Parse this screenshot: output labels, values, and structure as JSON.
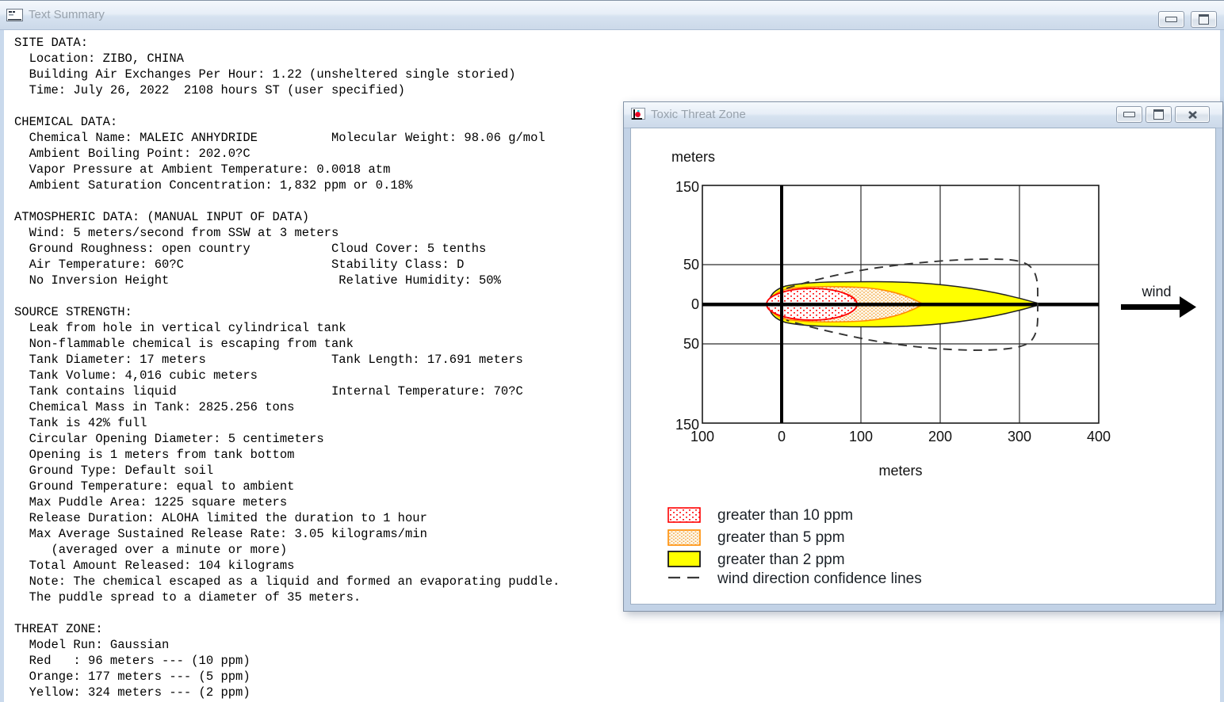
{
  "text_summary_window": {
    "title": "Text Summary",
    "icon": "text-document-icon",
    "controls": {
      "minimize": "Minimize",
      "maximize": "Maximize"
    },
    "content": "SITE DATA:\n  Location: ZIBO, CHINA\n  Building Air Exchanges Per Hour: 1.22 (unsheltered single storied)\n  Time: July 26, 2022  2108 hours ST (user specified)\n\nCHEMICAL DATA:\n  Chemical Name: MALEIC ANHYDRIDE          Molecular Weight: 98.06 g/mol\n  Ambient Boiling Point: 202.0?C\n  Vapor Pressure at Ambient Temperature: 0.0018 atm\n  Ambient Saturation Concentration: 1,832 ppm or 0.18%\n\nATMOSPHERIC DATA: (MANUAL INPUT OF DATA)\n  Wind: 5 meters/second from SSW at 3 meters\n  Ground Roughness: open country           Cloud Cover: 5 tenths\n  Air Temperature: 60?C                    Stability Class: D\n  No Inversion Height                       Relative Humidity: 50%\n\nSOURCE STRENGTH:\n  Leak from hole in vertical cylindrical tank\n  Non-flammable chemical is escaping from tank\n  Tank Diameter: 17 meters                 Tank Length: 17.691 meters\n  Tank Volume: 4,016 cubic meters\n  Tank contains liquid                     Internal Temperature: 70?C\n  Chemical Mass in Tank: 2825.256 tons\n  Tank is 42% full\n  Circular Opening Diameter: 5 centimeters\n  Opening is 1 meters from tank bottom\n  Ground Type: Default soil\n  Ground Temperature: equal to ambient\n  Max Puddle Area: 1225 square meters\n  Release Duration: ALOHA limited the duration to 1 hour\n  Max Average Sustained Release Rate: 3.05 kilograms/min\n     (averaged over a minute or more)\n  Total Amount Released: 104 kilograms\n  Note: The chemical escaped as a liquid and formed an evaporating puddle.\n  The puddle spread to a diameter of 35 meters.\n\nTHREAT ZONE:\n  Model Run: Gaussian\n  Red   : 96 meters --- (10 ppm)\n  Orange: 177 meters --- (5 ppm)\n  Yellow: 324 meters --- (2 ppm)"
  },
  "toxic_window": {
    "title": "Toxic Threat Zone",
    "icon": "threat-plot-icon",
    "controls": {
      "minimize": "Minimize",
      "restore": "Restore",
      "close": "Close"
    }
  },
  "chart_data": {
    "type": "area",
    "title": "Toxic Threat Zone",
    "xlabel": "meters",
    "ylabel": "meters",
    "xlim": [
      -100,
      400
    ],
    "ylim": [
      -150,
      150
    ],
    "x_tick_labels": [
      "100",
      "0",
      "100",
      "200",
      "300",
      "400"
    ],
    "y_tick_labels": [
      "150",
      "50",
      "0",
      "50",
      "150"
    ],
    "grid": true,
    "legend_position": "bottom-left",
    "wind_label": "wind",
    "series": [
      {
        "name": "greater than 10 ppm",
        "threshold_ppm": 10,
        "downwind_extent_m": 96,
        "upwind_extent_m": -19,
        "max_half_width_m": 20,
        "outline_color": "#ff0000",
        "fill": "red dot pattern on white"
      },
      {
        "name": "greater than 5 ppm",
        "threshold_ppm": 5,
        "downwind_extent_m": 177,
        "upwind_extent_m": -14,
        "max_half_width_m": 22,
        "outline_color": "#ff8c00",
        "fill": "orange dot pattern on white"
      },
      {
        "name": "greater than 2 ppm",
        "threshold_ppm": 2,
        "downwind_extent_m": 324,
        "upwind_extent_m": -16,
        "max_half_width_m": 28,
        "outline_color": "#1a1a1a",
        "fill": "#ffff00"
      },
      {
        "name": "wind direction confidence lines",
        "style": "dashed",
        "downwind_extent_m": 323,
        "max_half_width_m": 57,
        "color": "#333333"
      }
    ]
  },
  "colors": {
    "red_zone": "#ff0000",
    "orange_zone": "#ff8c00",
    "yellow_zone": "#ffff00",
    "dashed_lines": "#333333",
    "titlebar_text": "#98a2ac"
  }
}
